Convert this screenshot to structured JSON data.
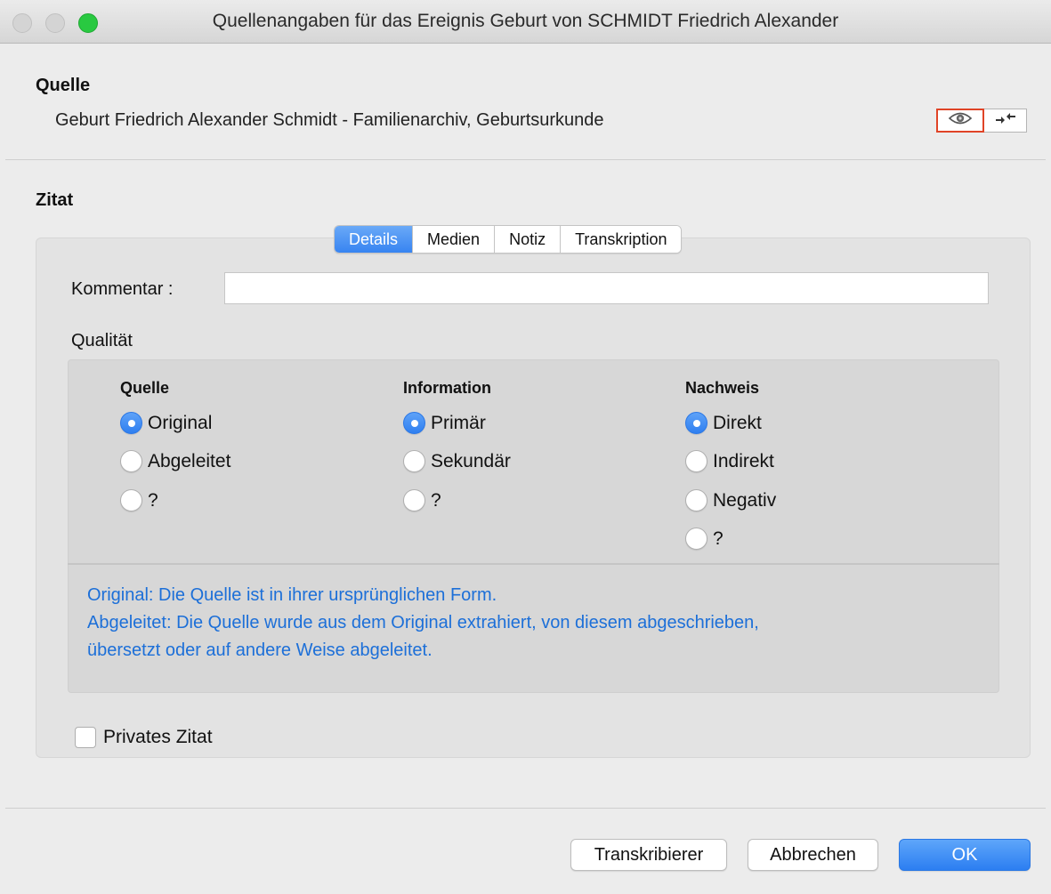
{
  "window": {
    "title": "Quellenangaben für das Ereignis Geburt von SCHMIDT Friedrich Alexander"
  },
  "source": {
    "section_label": "Quelle",
    "name": "Geburt Friedrich Alexander Schmidt - Familienarchiv, Geburtsurkunde",
    "view_icon": "eye-icon",
    "link_icon": "arrows-link-icon"
  },
  "citation": {
    "section_label": "Zitat",
    "tabs": [
      {
        "label": "Details",
        "active": true
      },
      {
        "label": "Medien",
        "active": false
      },
      {
        "label": "Notiz",
        "active": false
      },
      {
        "label": "Transkription",
        "active": false
      }
    ],
    "comment_label": "Kommentar :",
    "comment_value": "",
    "quality_label": "Qualität",
    "quality": {
      "quelle": {
        "header": "Quelle",
        "options": [
          {
            "label": "Original",
            "selected": true
          },
          {
            "label": "Abgeleitet",
            "selected": false
          },
          {
            "label": "?",
            "selected": false
          }
        ]
      },
      "information": {
        "header": "Information",
        "options": [
          {
            "label": "Primär",
            "selected": true
          },
          {
            "label": "Sekundär",
            "selected": false
          },
          {
            "label": "?",
            "selected": false
          }
        ]
      },
      "nachweis": {
        "header": "Nachweis",
        "options": [
          {
            "label": "Direkt",
            "selected": true
          },
          {
            "label": "Indirekt",
            "selected": false
          },
          {
            "label": "Negativ",
            "selected": false
          },
          {
            "label": "?",
            "selected": false
          }
        ]
      }
    },
    "description": [
      "Original: Die Quelle ist in ihrer ursprünglichen Form.",
      "Abgeleitet: Die Quelle wurde aus dem Original extrahiert, von diesem abgeschrieben,",
      "übersetzt oder auf andere Weise abgeleitet."
    ],
    "private_label": "Privates Zitat",
    "private_checked": false
  },
  "buttons": {
    "transcriber": "Transkribierer",
    "cancel": "Abbrechen",
    "ok": "OK"
  },
  "colors": {
    "accent": "#3784f1",
    "description_text": "#1c6fd8",
    "highlight_border": "#e04427"
  }
}
